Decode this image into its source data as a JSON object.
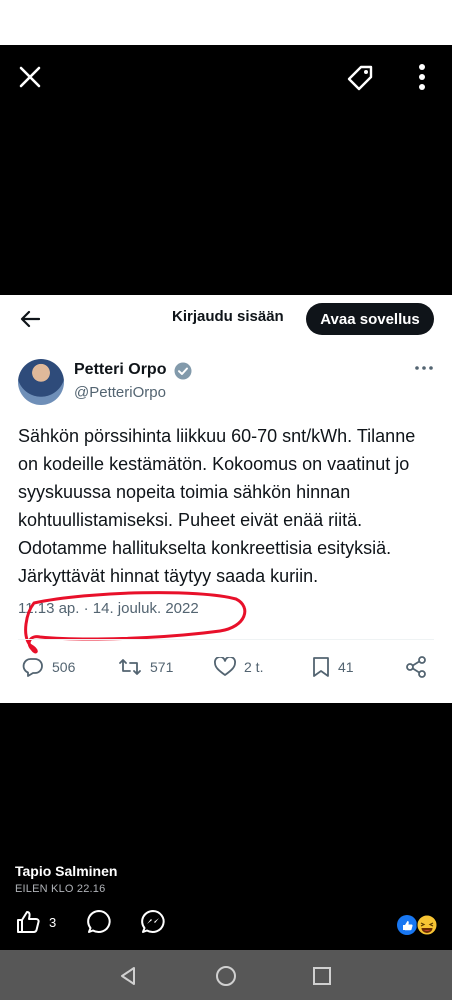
{
  "viewer": {
    "close_icon": "close-icon",
    "tag_icon": "tag-icon",
    "more_icon": "more-vertical-icon"
  },
  "card_header": {
    "login_label": "Kirjaudu sisään",
    "open_app_label": "Avaa sovellus"
  },
  "tweet": {
    "author_name": "Petteri Orpo",
    "handle": "@PetteriOrpo",
    "text": "Sähkön pörssihinta liikkuu 60-70 snt/kWh. Tilanne on kodeille kestämätön. Kokoomus on vaatinut jo syyskuussa nopeita toimia sähkön hinnan kohtuullistamiseksi. Puheet eivät enää riitä. Odotamme hallitukselta konkreettisia esityksiä. Järkyttävät hinnat täytyy saada kuriin.",
    "timestamp": "11.13 ap. · 14. jouluk. 2022",
    "replies": "506",
    "retweets": "571",
    "likes": "2 t.",
    "bookmarks": "41",
    "annotation_color": "#e8102a"
  },
  "facebook": {
    "poster_name": "Tapio Salminen",
    "post_time": "EILEN KLO 22.16",
    "like_count": "3"
  },
  "navbar": {
    "back_icon": "triangle-back-icon",
    "home_icon": "circle-home-icon",
    "recents_icon": "square-recents-icon"
  }
}
